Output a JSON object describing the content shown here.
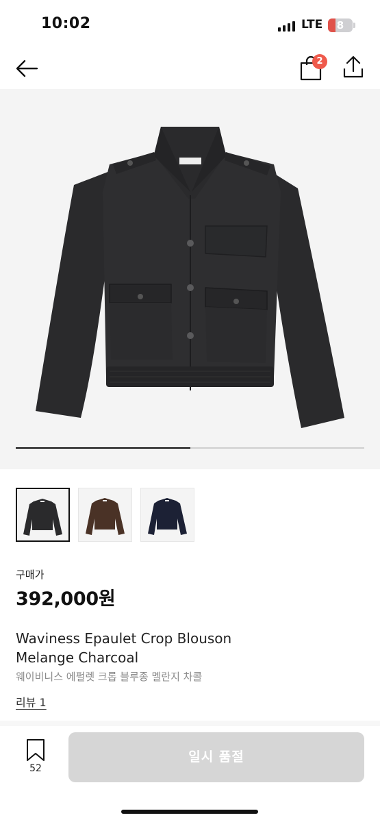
{
  "status_bar": {
    "time": "10:02",
    "network": "LTE",
    "battery_level": "8",
    "battery_fraction": 0.08,
    "battery_color": "#e0524a"
  },
  "nav": {
    "back_icon": "arrow-left-icon",
    "cart_icon": "shopping-bag-icon",
    "cart_badge": "2",
    "share_icon": "share-icon"
  },
  "hero": {
    "image": "charcoal-jacket",
    "background": "#f4f4f4",
    "carousel_progress": 0.5
  },
  "thumbnails": [
    {
      "color": "charcoal",
      "swatch": "#2a2a2c",
      "selected": true
    },
    {
      "color": "brown",
      "swatch": "#4a3226",
      "selected": false
    },
    {
      "color": "navy",
      "swatch": "#1c2135",
      "selected": false
    }
  ],
  "product": {
    "price_label": "구매가",
    "price": "392,000원",
    "name_en_line1": "Waviness Epaulet Crop Blouson",
    "name_en_line2": "Melange Charcoal",
    "name_kr": "웨이비니스 에펄렛 크롭 블루종 멜란지 차콜",
    "review_link": "리뷰 1"
  },
  "bottom_bar": {
    "bookmark_icon": "bookmark-icon",
    "wish_count": "52",
    "action_label": "일시 품절",
    "action_color": "#d6d6d6"
  }
}
